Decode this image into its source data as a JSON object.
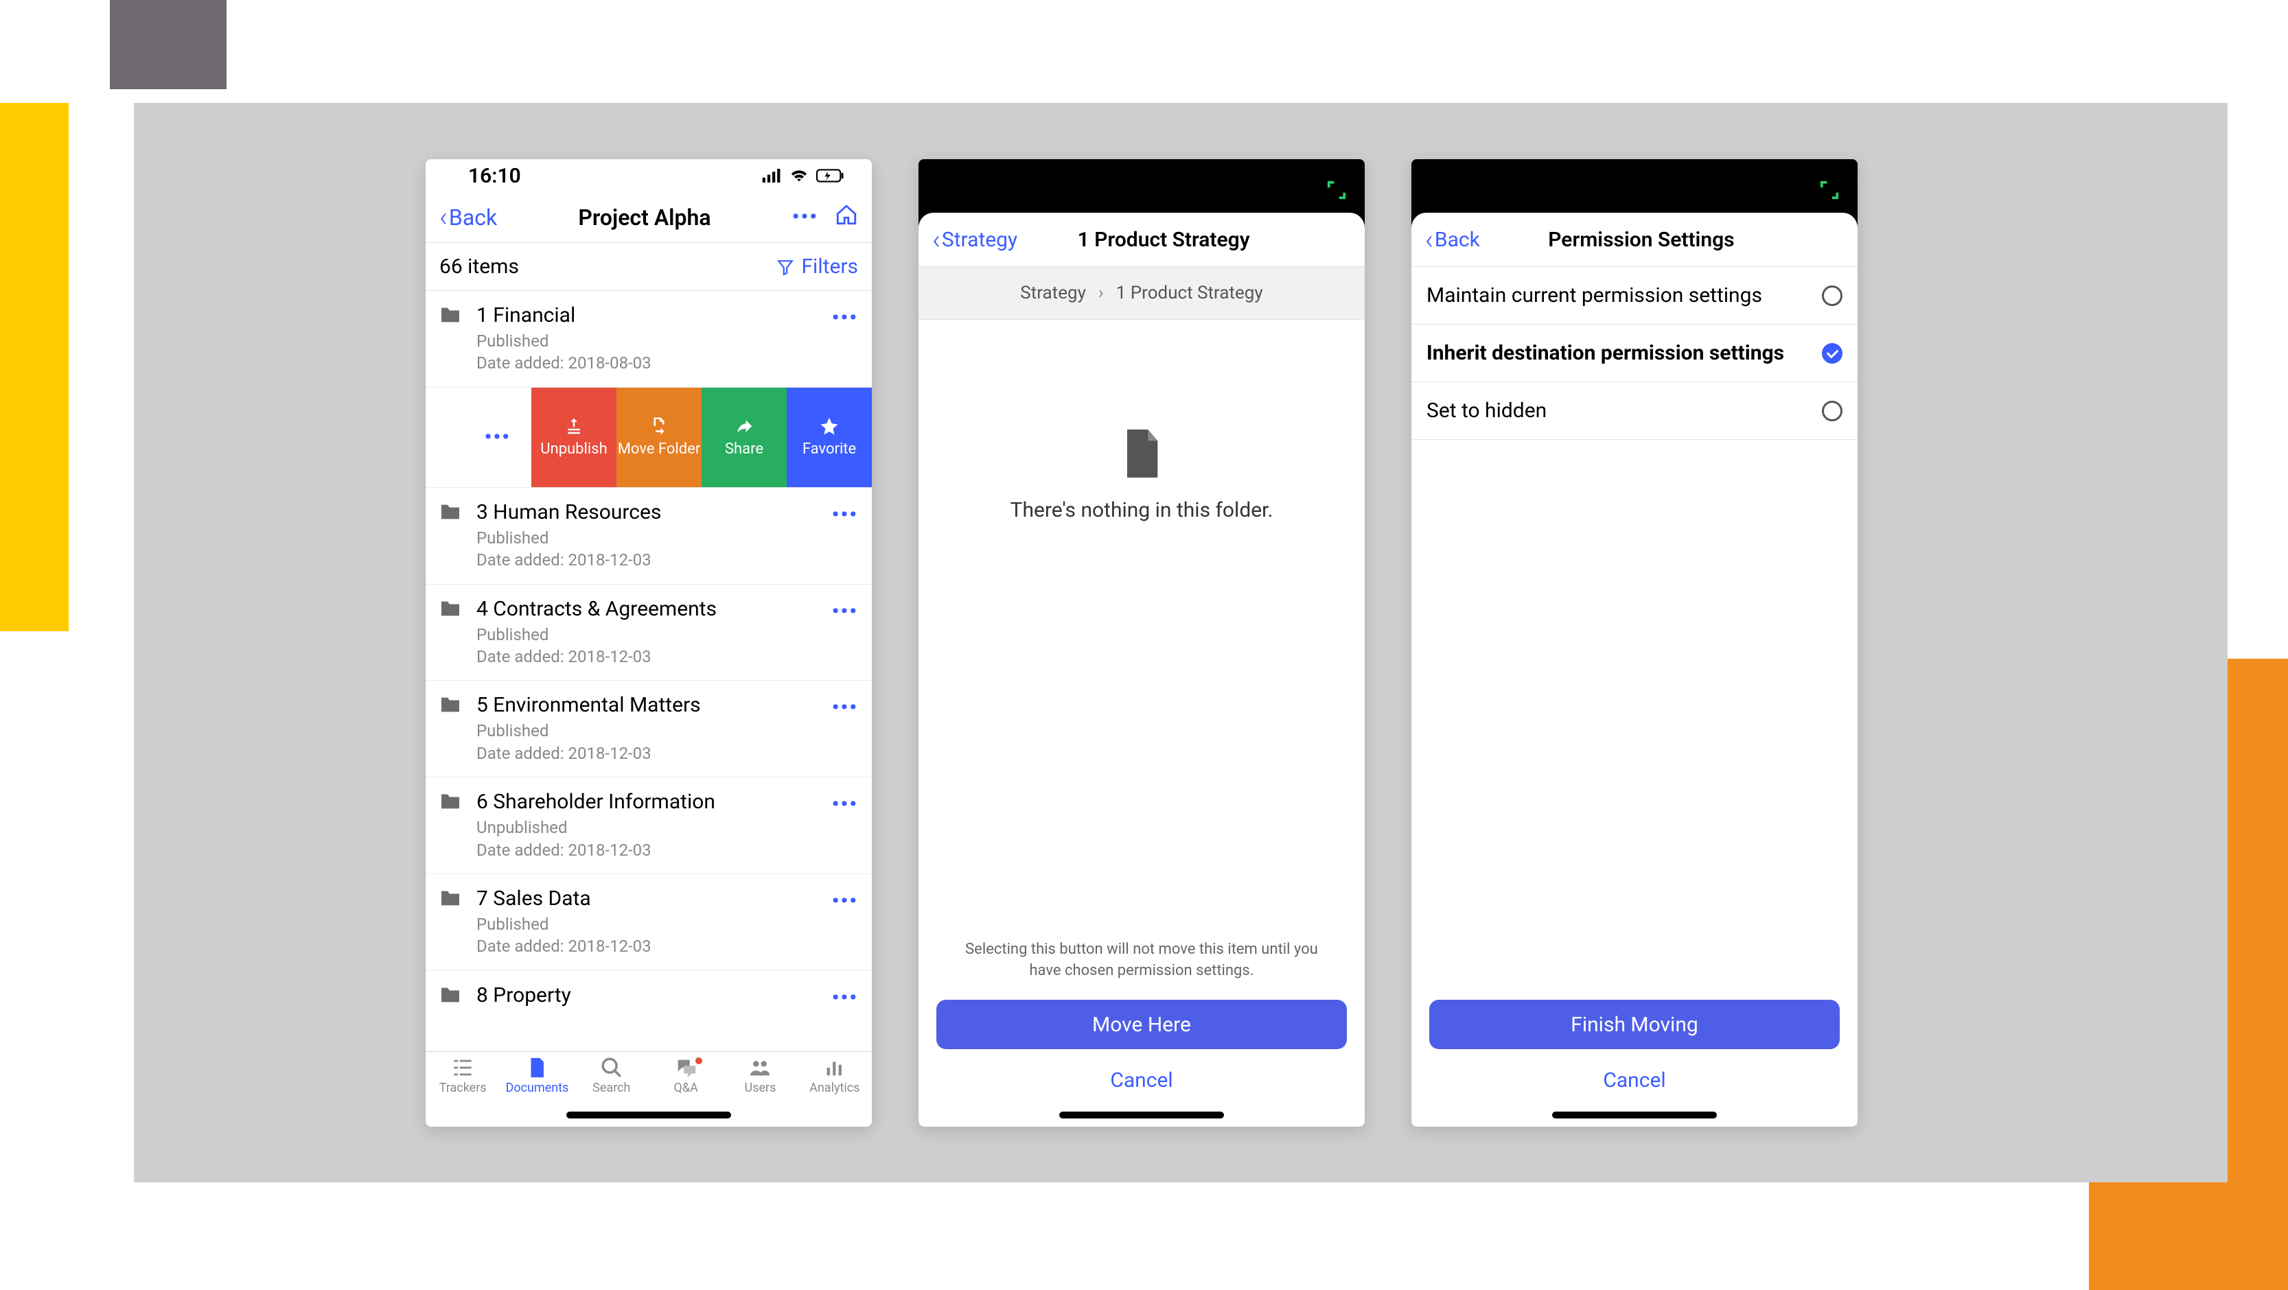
{
  "phone1": {
    "status_time": "16:10",
    "back_label": "Back",
    "title": "Project Alpha",
    "item_count": "66 items",
    "filters_label": "Filters",
    "swipe": {
      "unpublish": "Unpublish",
      "move": "Move Folder",
      "share": "Share",
      "favorite": "Favorite"
    },
    "rows": [
      {
        "name": "1 Financial",
        "status": "Published",
        "date": "Date added: 2018-08-03"
      },
      {
        "name": "3 Human Resources",
        "status": "Published",
        "date": "Date added: 2018-12-03"
      },
      {
        "name": "4 Contracts & Agreements",
        "status": "Published",
        "date": "Date added: 2018-12-03"
      },
      {
        "name": "5 Environmental Matters",
        "status": "Published",
        "date": "Date added: 2018-12-03"
      },
      {
        "name": "6 Shareholder Information",
        "status": "Unpublished",
        "date": "Date added: 2018-12-03"
      },
      {
        "name": "7 Sales Data",
        "status": "Published",
        "date": "Date added: 2018-12-03"
      },
      {
        "name": "8 Property",
        "status": "",
        "date": ""
      }
    ],
    "tabs": {
      "trackers": "Trackers",
      "documents": "Documents",
      "search": "Search",
      "qa": "Q&A",
      "users": "Users",
      "analytics": "Analytics"
    }
  },
  "phone2": {
    "back_label": "Strategy",
    "title": "1 Product Strategy",
    "crumb_root": "Strategy",
    "crumb_leaf": "1 Product Strategy",
    "empty_msg": "There's nothing in this folder.",
    "hint": "Selecting this button will not move this item until you have chosen permission settings.",
    "primary": "Move Here",
    "cancel": "Cancel"
  },
  "phone3": {
    "back_label": "Back",
    "title": "Permission Settings",
    "options": [
      {
        "label": "Maintain current permission settings",
        "selected": false
      },
      {
        "label": "Inherit destination permission settings",
        "selected": true
      },
      {
        "label": "Set to hidden",
        "selected": false
      }
    ],
    "primary": "Finish Moving",
    "cancel": "Cancel"
  }
}
